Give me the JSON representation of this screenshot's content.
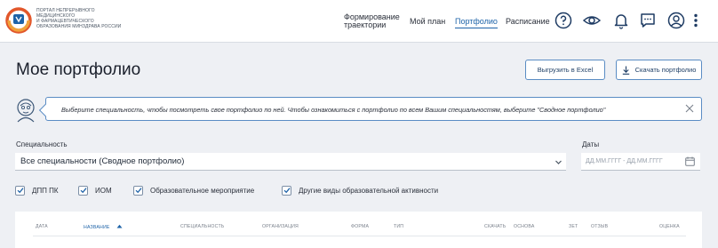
{
  "header": {
    "logo_lines": [
      "ПОРТАЛ НЕПРЕРЫВНОГО",
      "МЕДИЦИНСКОГО",
      "И ФАРМАЦЕВТИЧЕСКОГО",
      "ОБРАЗОВАНИЯ МИНЗДРАВА РОССИИ"
    ],
    "nav": {
      "trajectory_line1": "Формирование",
      "trajectory_line2": "траектории",
      "my_plan": "Мой план",
      "portfolio": "Портфолио",
      "schedule": "Расписание"
    },
    "icons": [
      "help-icon",
      "eye-icon",
      "bell-icon",
      "chat-icon",
      "user-icon",
      "more-vertical-icon"
    ],
    "accent_color": "#1e63a8"
  },
  "page": {
    "title": "Мое портфолио",
    "export_excel": "Выгрузить в Excel",
    "download_portfolio": "Скачать портфолио"
  },
  "info": {
    "text": "Выберите специальность, чтобы посмотреть свое портфолио по ней. Чтобы ознакомиться с портфолио по всем Вашим специальностям, выберите \"Сводное портфолио\""
  },
  "filters": {
    "specialty_label": "Специальность",
    "specialty_value": "Все специальности (Сводное портфолио)",
    "dates_label": "Даты",
    "dates_placeholder": "ДД.ММ.ГГГГ - ДД.ММ.ГГГГ",
    "checkboxes": [
      {
        "label": "ДПП ПК",
        "checked": true
      },
      {
        "label": "ИОМ",
        "checked": true
      },
      {
        "label": "Образовательное мероприятие",
        "checked": true
      },
      {
        "label": "Другие виды образовательной активности",
        "checked": true
      }
    ]
  },
  "table": {
    "columns": [
      "ДАТА",
      "НАЗВАНИЕ",
      "СПЕЦИАЛЬНОСТЬ",
      "ОРГАНИЗАЦИЯ",
      "ФОРМА",
      "ТИП",
      "СКАЧАТЬ",
      "ОСНОВА",
      "ЗЕТ",
      "ОТЗЫВ",
      "ОЦЕНКА"
    ],
    "sorted_column": "НАЗВАНИЕ"
  }
}
